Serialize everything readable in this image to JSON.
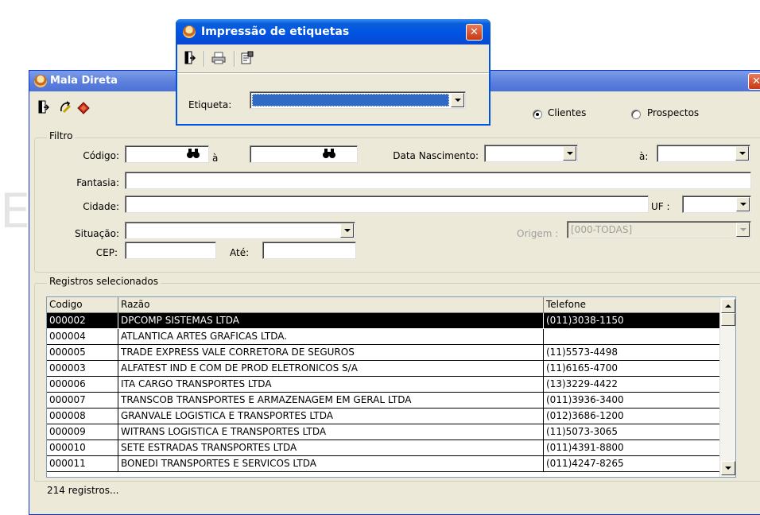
{
  "background_watermark": "Ev",
  "main_window": {
    "title": "Mala Direta",
    "radio_clientes": "Clientes",
    "radio_prospectos": "Prospectos",
    "filtro": {
      "legend": "Filtro",
      "codigo_label": "Código:",
      "codigo_a_label": "à",
      "data_nascimento_label": "Data Nascimento:",
      "data_a_label": "à:",
      "fantasia_label": "Fantasia:",
      "cidade_label": "Cidade:",
      "uf_label": "UF :",
      "situacao_label": "Situação:",
      "origem_label": "Origem :",
      "origem_value": "[000-TODAS]",
      "cep_label": "CEP:",
      "ate_label": "Até:"
    },
    "registros": {
      "legend": "Registros selecionados",
      "columns": [
        "Codigo",
        "Razão",
        "Telefone"
      ],
      "rows": [
        {
          "codigo": "000002",
          "razao": "DPCOMP SISTEMAS LTDA",
          "telefone": "(011)3038-1150"
        },
        {
          "codigo": "000004",
          "razao": "ATLANTICA ARTES GRAFICAS LTDA.",
          "telefone": ""
        },
        {
          "codigo": "000005",
          "razao": "TRADE EXPRESS VALE CORRETORA DE SEGUROS",
          "telefone": "(11)5573-4498"
        },
        {
          "codigo": "000003",
          "razao": "ALFATEST IND E COM DE PROD ELETRONICOS S/A",
          "telefone": "(11)6165-4700"
        },
        {
          "codigo": "000006",
          "razao": "ITA CARGO TRANSPORTES LTDA",
          "telefone": "(13)3229-4422"
        },
        {
          "codigo": "000007",
          "razao": "TRANSCOB TRANSPORTES E ARMAZENAGEM EM GERAL LTDA",
          "telefone": "(011)3936-3400"
        },
        {
          "codigo": "000008",
          "razao": "GRANVALE LOGISTICA E TRANSPORTES LTDA",
          "telefone": "(012)3686-1200"
        },
        {
          "codigo": "000009",
          "razao": "WITRANS LOGISTICA E TRANSPORTES LTDA",
          "telefone": "(11)5073-3065"
        },
        {
          "codigo": "000010",
          "razao": "SETE ESTRADAS TRANSPORTES LTDA",
          "telefone": "(011)4391-8800"
        },
        {
          "codigo": "000011",
          "razao": "BONEDI TRANSPORTES E SERVICOS LTDA",
          "telefone": "(011)4247-8265"
        }
      ],
      "status": "214 registros..."
    }
  },
  "popup": {
    "title": "Impressão de etiquetas",
    "etiqueta_label": "Etiqueta:",
    "etiqueta_value": ""
  }
}
